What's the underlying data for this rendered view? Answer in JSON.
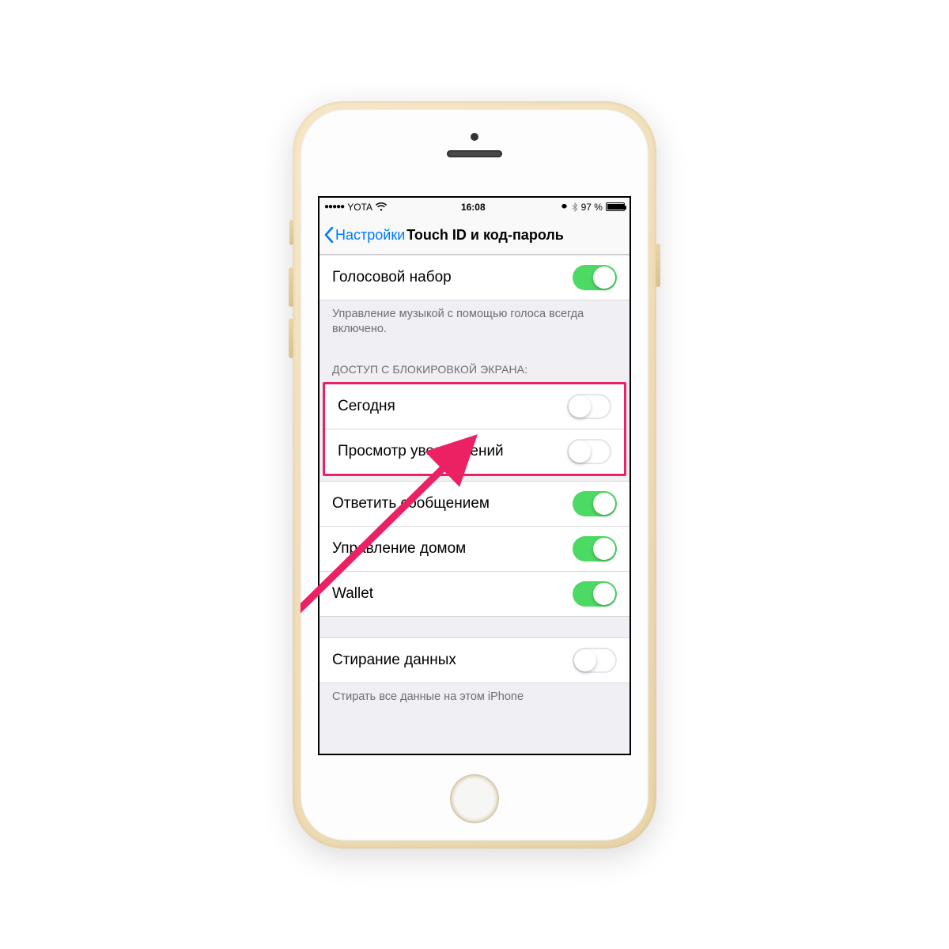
{
  "statusBar": {
    "carrier": "YOTA",
    "time": "16:08",
    "batteryPct": "97 %"
  },
  "nav": {
    "backLabel": "Настройки",
    "title": "Touch ID и код-пароль"
  },
  "rows": {
    "voiceDial": {
      "label": "Голосовой набор",
      "on": true
    },
    "voiceDialNote": "Управление музыкой с помощью голоса всегда включено.",
    "lockScreenHeader": "ДОСТУП С БЛОКИРОВКОЙ ЭКРАНА:",
    "today": {
      "label": "Сегодня",
      "on": false
    },
    "notificationsView": {
      "label": "Просмотр уведомлений",
      "on": false
    },
    "replyWithMessage": {
      "label": "Ответить сообщением",
      "on": true
    },
    "homeControl": {
      "label": "Управление домом",
      "on": true
    },
    "wallet": {
      "label": "Wallet",
      "on": true
    },
    "eraseData": {
      "label": "Стирание данных",
      "on": false
    },
    "eraseDataNote": "Стирать все данные на этом iPhone"
  }
}
